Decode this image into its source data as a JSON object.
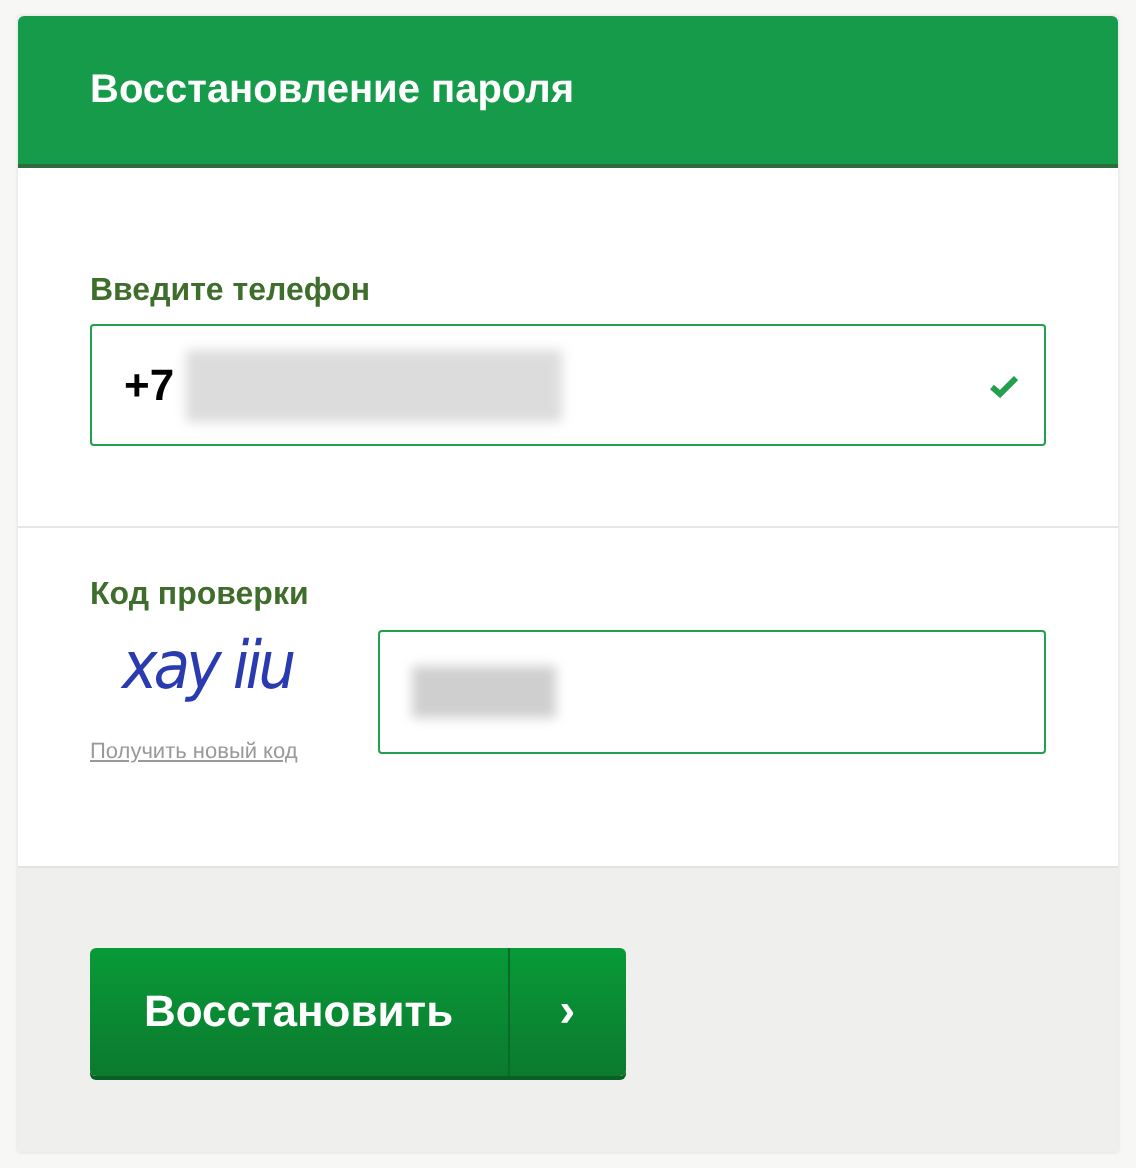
{
  "header": {
    "title": "Восстановление пароля"
  },
  "phone": {
    "label": "Введите телефон",
    "value": "+7",
    "redacted": true,
    "valid": true
  },
  "captcha": {
    "label": "Код проверки",
    "code": "xay iiu",
    "refresh_link": "Получить новый код",
    "input_redacted": true
  },
  "submit": {
    "label": "Восстановить",
    "arrow": "›"
  }
}
